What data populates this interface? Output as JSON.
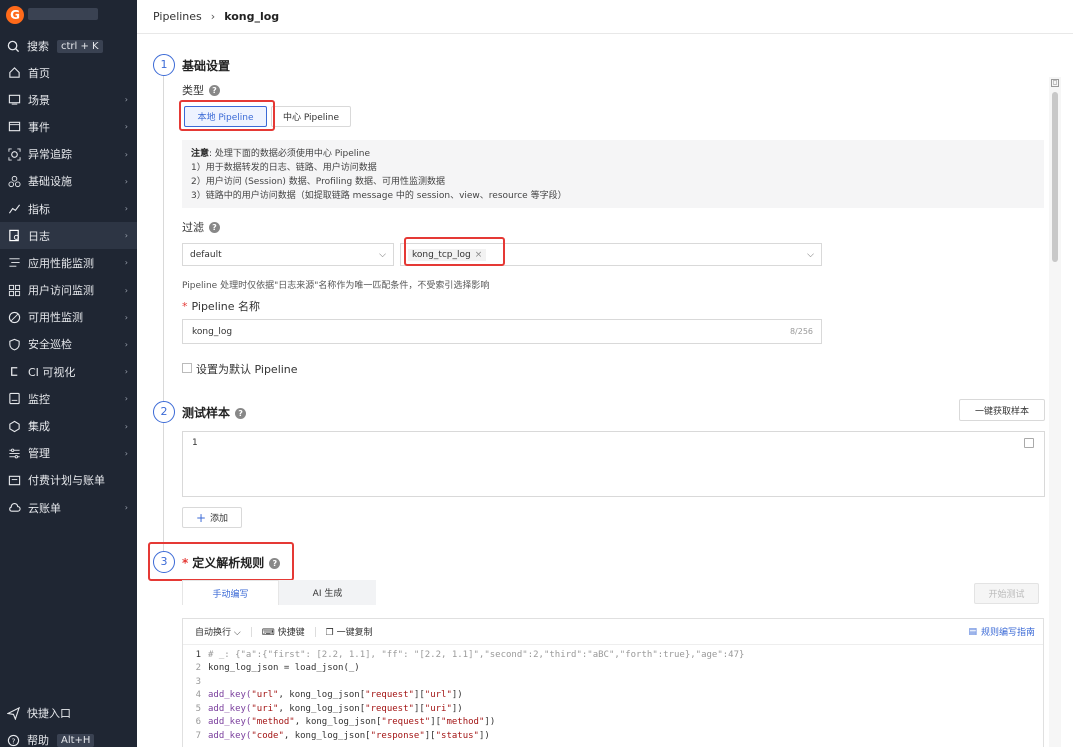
{
  "sidebar": {
    "search_label": "搜索",
    "search_shortcut": "ctrl + K",
    "items": [
      {
        "label": "首页",
        "icon": "home-icon",
        "arrow": false
      },
      {
        "label": "场景",
        "icon": "scene-icon",
        "arrow": true
      },
      {
        "label": "事件",
        "icon": "event-icon",
        "arrow": true
      },
      {
        "label": "异常追踪",
        "icon": "exception-icon",
        "arrow": true
      },
      {
        "label": "基础设施",
        "icon": "infrastructure-icon",
        "arrow": true
      },
      {
        "label": "指标",
        "icon": "metrics-icon",
        "arrow": true
      },
      {
        "label": "日志",
        "icon": "log-icon",
        "arrow": true,
        "active": true
      },
      {
        "label": "应用性能监测",
        "icon": "apm-icon",
        "arrow": true
      },
      {
        "label": "用户访问监测",
        "icon": "rum-icon",
        "arrow": true
      },
      {
        "label": "可用性监测",
        "icon": "availability-icon",
        "arrow": true
      },
      {
        "label": "安全巡检",
        "icon": "security-icon",
        "arrow": true
      },
      {
        "label": "CI 可视化",
        "icon": "ci-icon",
        "arrow": true
      },
      {
        "label": "监控",
        "icon": "monitor-icon",
        "arrow": true
      },
      {
        "label": "集成",
        "icon": "integration-icon",
        "arrow": true
      },
      {
        "label": "管理",
        "icon": "manage-icon",
        "arrow": true
      },
      {
        "label": "付费计划与账单",
        "icon": "billing-icon",
        "arrow": false
      },
      {
        "label": "云账单",
        "icon": "cloud-bill-icon",
        "arrow": true
      }
    ],
    "quick_entry": "快捷入口",
    "help_label": "帮助",
    "help_shortcut": "Alt+H"
  },
  "header": {
    "breadcrumb_root": "Pipelines",
    "breadcrumb_current": "kong_log"
  },
  "step1": {
    "num": "1",
    "title": "基础设置",
    "type_label": "类型",
    "local_btn": "本地 Pipeline",
    "center_btn": "中心 Pipeline",
    "notice_title": "注意",
    "notice_head": ": 处理下面的数据必须使用中心 Pipeline",
    "notice_1": "1）用于数据转发的日志、链路、用户访问数据",
    "notice_2": "2）用户访问 (Session) 数据、Profiling 数据、可用性监测数据",
    "notice_3": "3）链路中的用户访问数据（如提取链路 message 中的 session、view、resource 等字段）",
    "filter_label": "过滤",
    "filter_select": "default",
    "filter_tag": "kong_tcp_log",
    "filter_hint": "Pipeline 处理时仅依据\"日志来源\"名称作为唯一匹配条件，不受索引选择影响",
    "name_label": "Pipeline 名称",
    "name_value": "kong_log",
    "name_counter": "8/256",
    "default_checkbox": "设置为默认 Pipeline"
  },
  "step2": {
    "num": "2",
    "title": "测试样本",
    "fetch_btn": "一键获取样本",
    "sample_value": "1",
    "add_btn": "添加"
  },
  "step3": {
    "num": "3",
    "title": "定义解析规则",
    "tab_manual": "手动编写",
    "tab_ai": "AI 生成",
    "start_test_btn": "开始测试",
    "toolbar_wrap": "自动换行",
    "toolbar_shortcut": "快捷键",
    "toolbar_copy": "一键复制",
    "toolbar_guide": "规则编写指南",
    "code_lines": [
      {
        "n": "1",
        "text": "# _: {\"a\":{\"first\": [2.2, 1.1], \"ff\": \"[2.2, 1.1]\",\"second\":2,\"third\":\"aBC\",\"forth\":true},\"age\":47}",
        "kind": "cmt"
      },
      {
        "n": "2",
        "text": "kong_log_json = load_json(_)",
        "kind": "plain"
      },
      {
        "n": "3",
        "text": "",
        "kind": "plain"
      },
      {
        "n": "4",
        "pre": "add_key(",
        "s1": "\"url\"",
        "mid": ", kong_log_json[",
        "s2": "\"request\"",
        "mid2": "][",
        "s3": "\"url\"",
        "post": "])",
        "kind": "call"
      },
      {
        "n": "5",
        "pre": "add_key(",
        "s1": "\"uri\"",
        "mid": ", kong_log_json[",
        "s2": "\"request\"",
        "mid2": "][",
        "s3": "\"uri\"",
        "post": "])",
        "kind": "call"
      },
      {
        "n": "6",
        "pre": "add_key(",
        "s1": "\"method\"",
        "mid": ", kong_log_json[",
        "s2": "\"request\"",
        "mid2": "][",
        "s3": "\"method\"",
        "post": "])",
        "kind": "call"
      },
      {
        "n": "7",
        "pre": "add_key(",
        "s1": "\"code\"",
        "mid": ", kong_log_json[",
        "s2": "\"response\"",
        "mid2": "][",
        "s3": "\"status\"",
        "post": "])",
        "kind": "call"
      }
    ]
  },
  "colors": {
    "accent": "#3b6ad6",
    "highlight_box": "#e53935",
    "sidebar_bg": "#1f2633",
    "brand": "#ff6a1a"
  }
}
